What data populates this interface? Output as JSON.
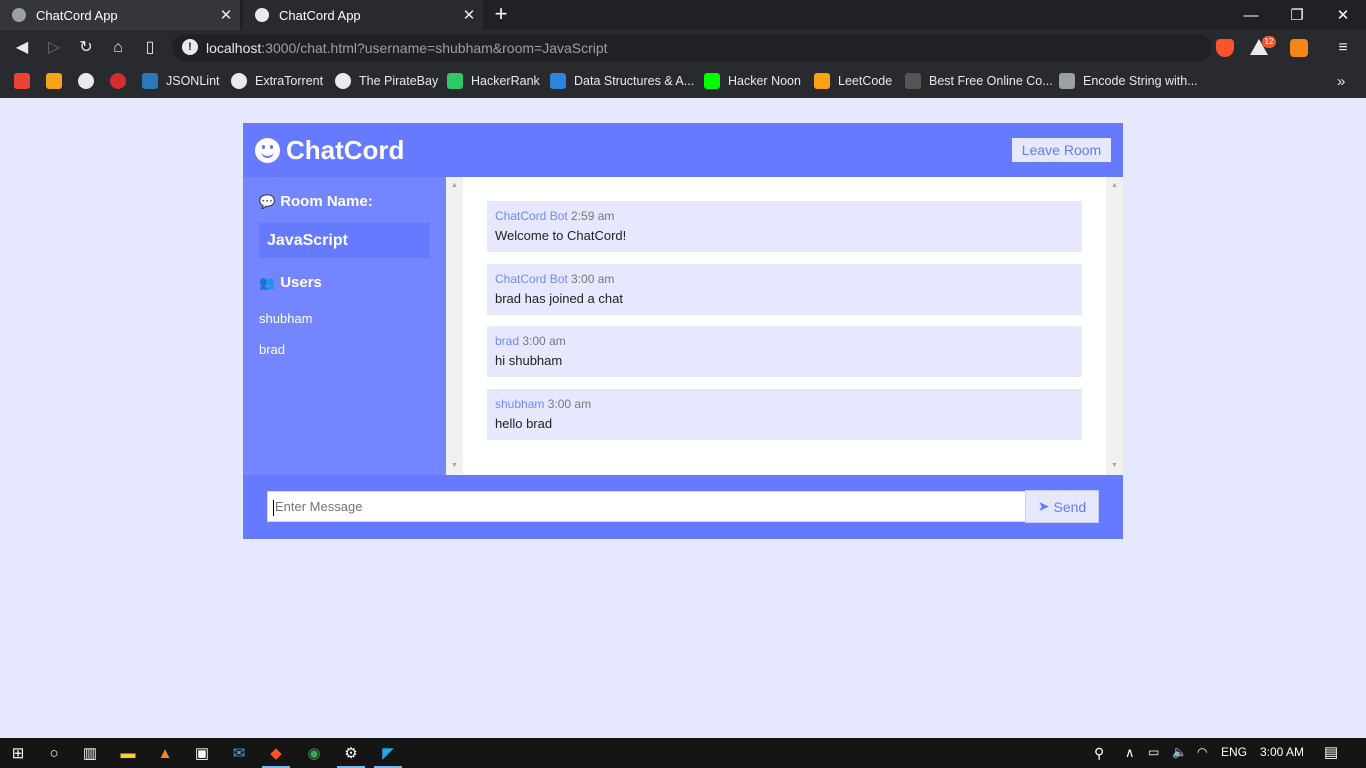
{
  "browser": {
    "tabs": [
      {
        "title": "ChatCord App",
        "active": false
      },
      {
        "title": "ChatCord App",
        "active": true
      }
    ],
    "new_tab": "+",
    "window_controls": {
      "minimize": "—",
      "restore": "❐",
      "close": "✕"
    },
    "url_host": "localhost",
    "url_rest": ":3000/chat.html?username=shubham&room=JavaScript",
    "shields_badge": "12",
    "bookmarks": [
      "JSONLint",
      "ExtraTorrent",
      "The PirateBay",
      "HackerRank",
      "Data Structures & A...",
      "Hacker Noon",
      "LeetCode",
      "Best Free Online Co...",
      "Encode String with..."
    ],
    "bookmarks_overflow": "»"
  },
  "app": {
    "title": "ChatCord",
    "leave_button": "Leave Room",
    "room_heading": "Room Name:",
    "room_name": "JavaScript",
    "users_heading": "Users",
    "users": [
      "shubham",
      "brad"
    ],
    "messages": [
      {
        "user": "ChatCord Bot",
        "time": "2:59 am",
        "text": "Welcome to ChatCord!"
      },
      {
        "user": "ChatCord Bot",
        "time": "3:00 am",
        "text": "brad has joined a chat"
      },
      {
        "user": "brad",
        "time": "3:00 am",
        "text": "hi shubham"
      },
      {
        "user": "shubham",
        "time": "3:00 am",
        "text": "hello brad"
      }
    ],
    "input_placeholder": "Enter Message",
    "send_button": "Send"
  },
  "taskbar": {
    "language": "ENG",
    "clock": "3:00 AM"
  },
  "colors": {
    "accent": "#667aff",
    "sidebar": "#7386ff",
    "light": "#e6e9fd"
  }
}
